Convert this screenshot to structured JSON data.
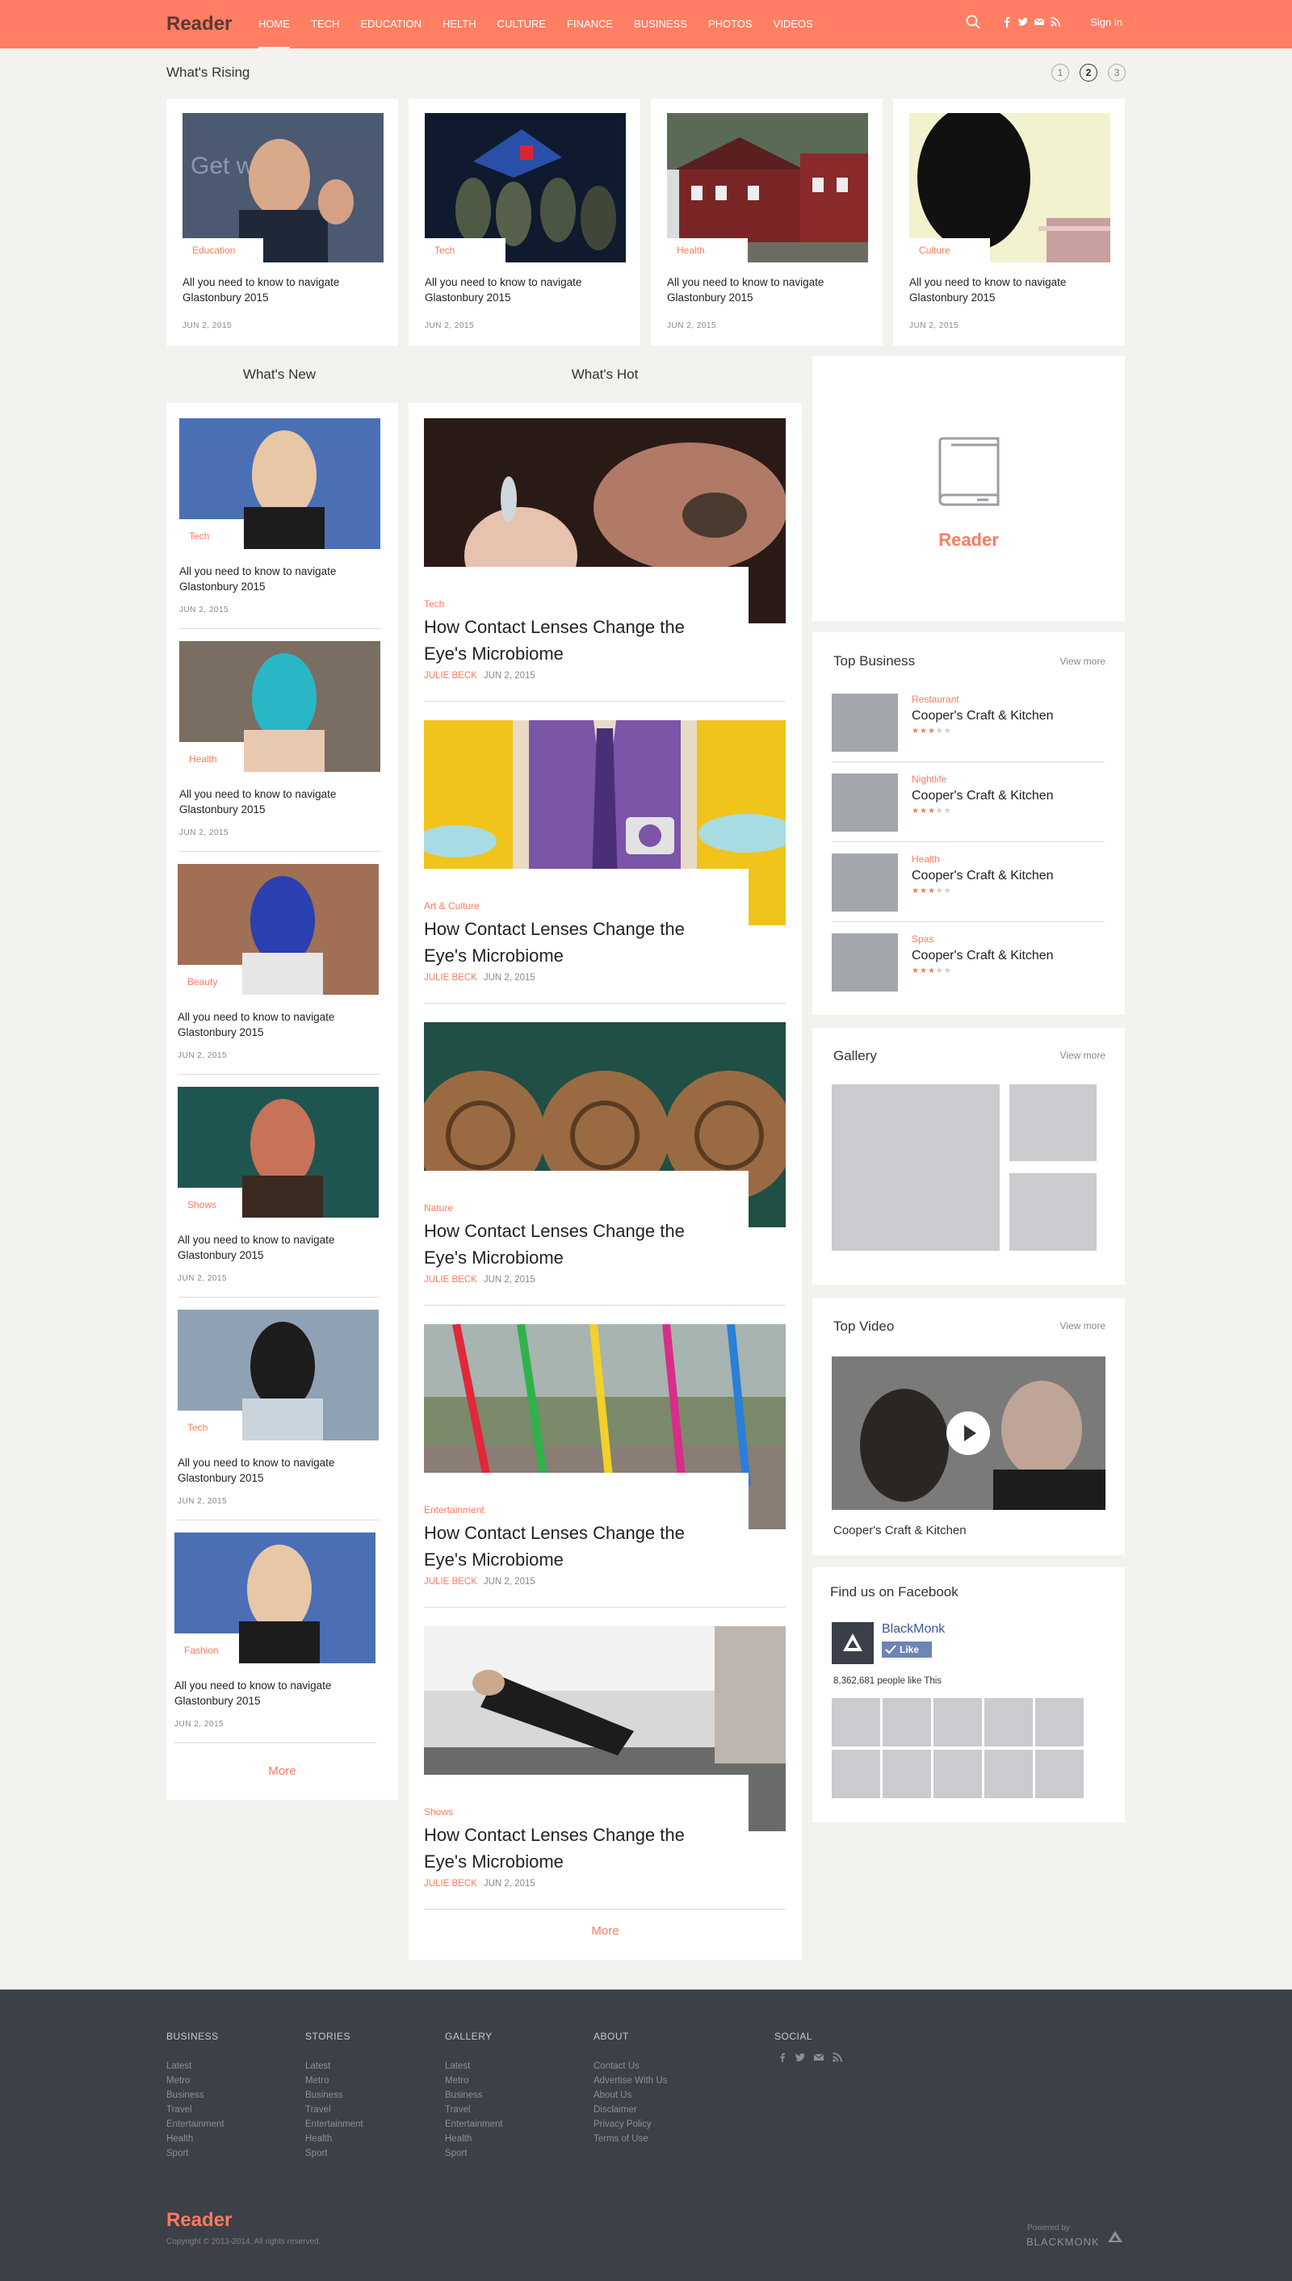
{
  "header": {
    "logo": "Reader",
    "nav": [
      "HOME",
      "TECH",
      "EDUCATION",
      "HELTH",
      "CULTURE",
      "FINANCE",
      "BUSINESS",
      "PHOTOS",
      "VIDEOS"
    ],
    "signin": "Sign in"
  },
  "rising": {
    "title": "What's Rising",
    "pages": [
      "1",
      "2",
      "3"
    ],
    "current_page": "2",
    "cards": [
      {
        "tag": "Education",
        "text": "All you need to know to navigate Glastonbury 2015",
        "date": "JUN 2, 2015"
      },
      {
        "tag": "Tech",
        "text": "All you need to know to navigate Glastonbury 2015",
        "date": "JUN 2, 2015"
      },
      {
        "tag": "Health",
        "text": "All you need to know to navigate Glastonbury 2015",
        "date": "JUN 2, 2015"
      },
      {
        "tag": "Culture",
        "text": "All you need to know to navigate Glastonbury 2015",
        "date": "JUN 2, 2015"
      }
    ]
  },
  "whats_new": {
    "title": "What's New",
    "items": [
      {
        "tag": "Tech",
        "text": "All you need to know to navigate Glastonbury 2015",
        "date": "JUN 2, 2015"
      },
      {
        "tag": "Health",
        "text": "All you need to know to navigate Glastonbury 2015",
        "date": "JUN 2, 2015"
      },
      {
        "tag": "Beauty",
        "text": "All you need to know to navigate Glastonbury 2015",
        "date": "JUN 2, 2015"
      },
      {
        "tag": "Shows",
        "text": "All you need to know to navigate Glastonbury 2015",
        "date": "JUN 2, 2015"
      },
      {
        "tag": "Tech",
        "text": "All you need to know to navigate Glastonbury 2015",
        "date": "JUN 2, 2015"
      },
      {
        "tag": "Fashion",
        "text": "All you need to know to navigate Glastonbury 2015",
        "date": "JUN 2, 2015"
      }
    ],
    "more": "More"
  },
  "whats_hot": {
    "title": "What's Hot",
    "items": [
      {
        "tag": "Tech",
        "title": "How Contact Lenses Change the Eye's Microbiome",
        "author": "JULIE BECK",
        "date": "JUN 2, 2015"
      },
      {
        "tag": "Art & Culture",
        "title": "How Contact Lenses Change the Eye's Microbiome",
        "author": "JULIE BECK",
        "date": "JUN 2, 2015"
      },
      {
        "tag": "Nature",
        "title": "How Contact Lenses Change the Eye's Microbiome",
        "author": "JULIE BECK",
        "date": "JUN 2, 2015"
      },
      {
        "tag": "Entertainment",
        "title": "How Contact Lenses Change the Eye's Microbiome",
        "author": "JULIE BECK",
        "date": "JUN 2, 2015"
      },
      {
        "tag": "Shows",
        "title": "How Contact Lenses Change the Eye's Microbiome",
        "author": "JULIE BECK",
        "date": "JUN 2, 2015"
      }
    ],
    "more": "More"
  },
  "sidebar": {
    "brand": "Reader",
    "top_business": {
      "title": "Top Business",
      "view_more": "View more",
      "items": [
        {
          "category": "Restaurant",
          "name": "Cooper's Craft & Kitchen",
          "rating": 3
        },
        {
          "category": "Nightlife",
          "name": "Cooper's Craft & Kitchen",
          "rating": 3
        },
        {
          "category": "Health",
          "name": "Cooper's Craft & Kitchen",
          "rating": 3
        },
        {
          "category": "Spas",
          "name": "Cooper's Craft & Kitchen",
          "rating": 3
        }
      ]
    },
    "gallery": {
      "title": "Gallery",
      "view_more": "View more"
    },
    "top_video": {
      "title": "Top Video",
      "view_more": "View more",
      "caption": "Cooper's Craft & Kitchen"
    },
    "facebook": {
      "title": "Find us on Facebook",
      "page_name": "BlackMonk",
      "like": "Like",
      "likes_text": "8,362,681 people like This"
    }
  },
  "footer": {
    "columns": [
      {
        "title": "BUSINESS",
        "links": [
          "Latest",
          "Metro",
          "Business",
          "Travel",
          "Entertainment",
          "Health",
          "Sport"
        ]
      },
      {
        "title": "STORIES",
        "links": [
          "Latest",
          "Metro",
          "Business",
          "Travel",
          "Entertainment",
          "Health",
          "Sport"
        ]
      },
      {
        "title": "GALLERY",
        "links": [
          "Latest",
          "Metro",
          "Business",
          "Travel",
          "Entertainment",
          "Health",
          "Sport"
        ]
      },
      {
        "title": "ABOUT",
        "links": [
          "Contact Us",
          "Advertise With Us",
          "About Us",
          "Disclaimer",
          "Privacy Policy",
          "Terms of Use"
        ]
      }
    ],
    "social_title": "SOCIAL",
    "logo": "Reader",
    "copyright": "Copyright © 2013-2014. All rights reserved.",
    "powered_by": "Powered by",
    "powered_brand": "BLACKMONK"
  },
  "colors": {
    "accent": "#ff7e64",
    "footer_bg": "#3c4049",
    "page_bg": "#f3f2ef"
  }
}
